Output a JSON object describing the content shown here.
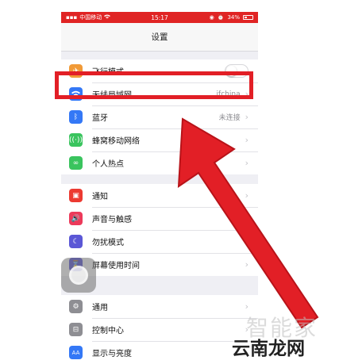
{
  "status_bar": {
    "carrier": "中国移动",
    "time": "15:17",
    "battery": "34%"
  },
  "nav": {
    "title": "设置"
  },
  "group1": [
    {
      "icon": "airplane-icon",
      "label": "飞行模式",
      "value": "",
      "toggle": true,
      "color": "#f19a37"
    },
    {
      "icon": "wifi-icon",
      "label": "无线局域网",
      "value": "jfchina",
      "color": "#3478f6"
    },
    {
      "icon": "bluetooth-icon",
      "label": "蓝牙",
      "value": "未连接",
      "color": "#3478f6"
    },
    {
      "icon": "cellular-icon",
      "label": "蜂窝移动网络",
      "value": "",
      "color": "#3ac45e"
    },
    {
      "icon": "hotspot-icon",
      "label": "个人热点",
      "value": "",
      "color": "#3ac45e"
    }
  ],
  "group2": [
    {
      "icon": "notification-icon",
      "label": "通知",
      "color": "#ec3a31"
    },
    {
      "icon": "sound-icon",
      "label": "声音与触感",
      "color": "#ec3a5a"
    },
    {
      "icon": "moon-icon",
      "label": "勿扰模式",
      "color": "#5b57d6"
    },
    {
      "icon": "hourglass-icon",
      "label": "屏幕使用时间",
      "color": "#5b57d6"
    }
  ],
  "group3": [
    {
      "icon": "gear-icon",
      "label": "通用",
      "color": "#8e8e93"
    },
    {
      "icon": "control-center-icon",
      "label": "控制中心",
      "color": "#8e8e93"
    },
    {
      "icon": "display-icon",
      "label": "显示与亮度",
      "color": "#3478f6"
    }
  ],
  "watermark": {
    "top": "智能家",
    "bottom": "云南龙网"
  },
  "colors": {
    "highlight": "#e21f26",
    "status_bar": "#e02424"
  }
}
